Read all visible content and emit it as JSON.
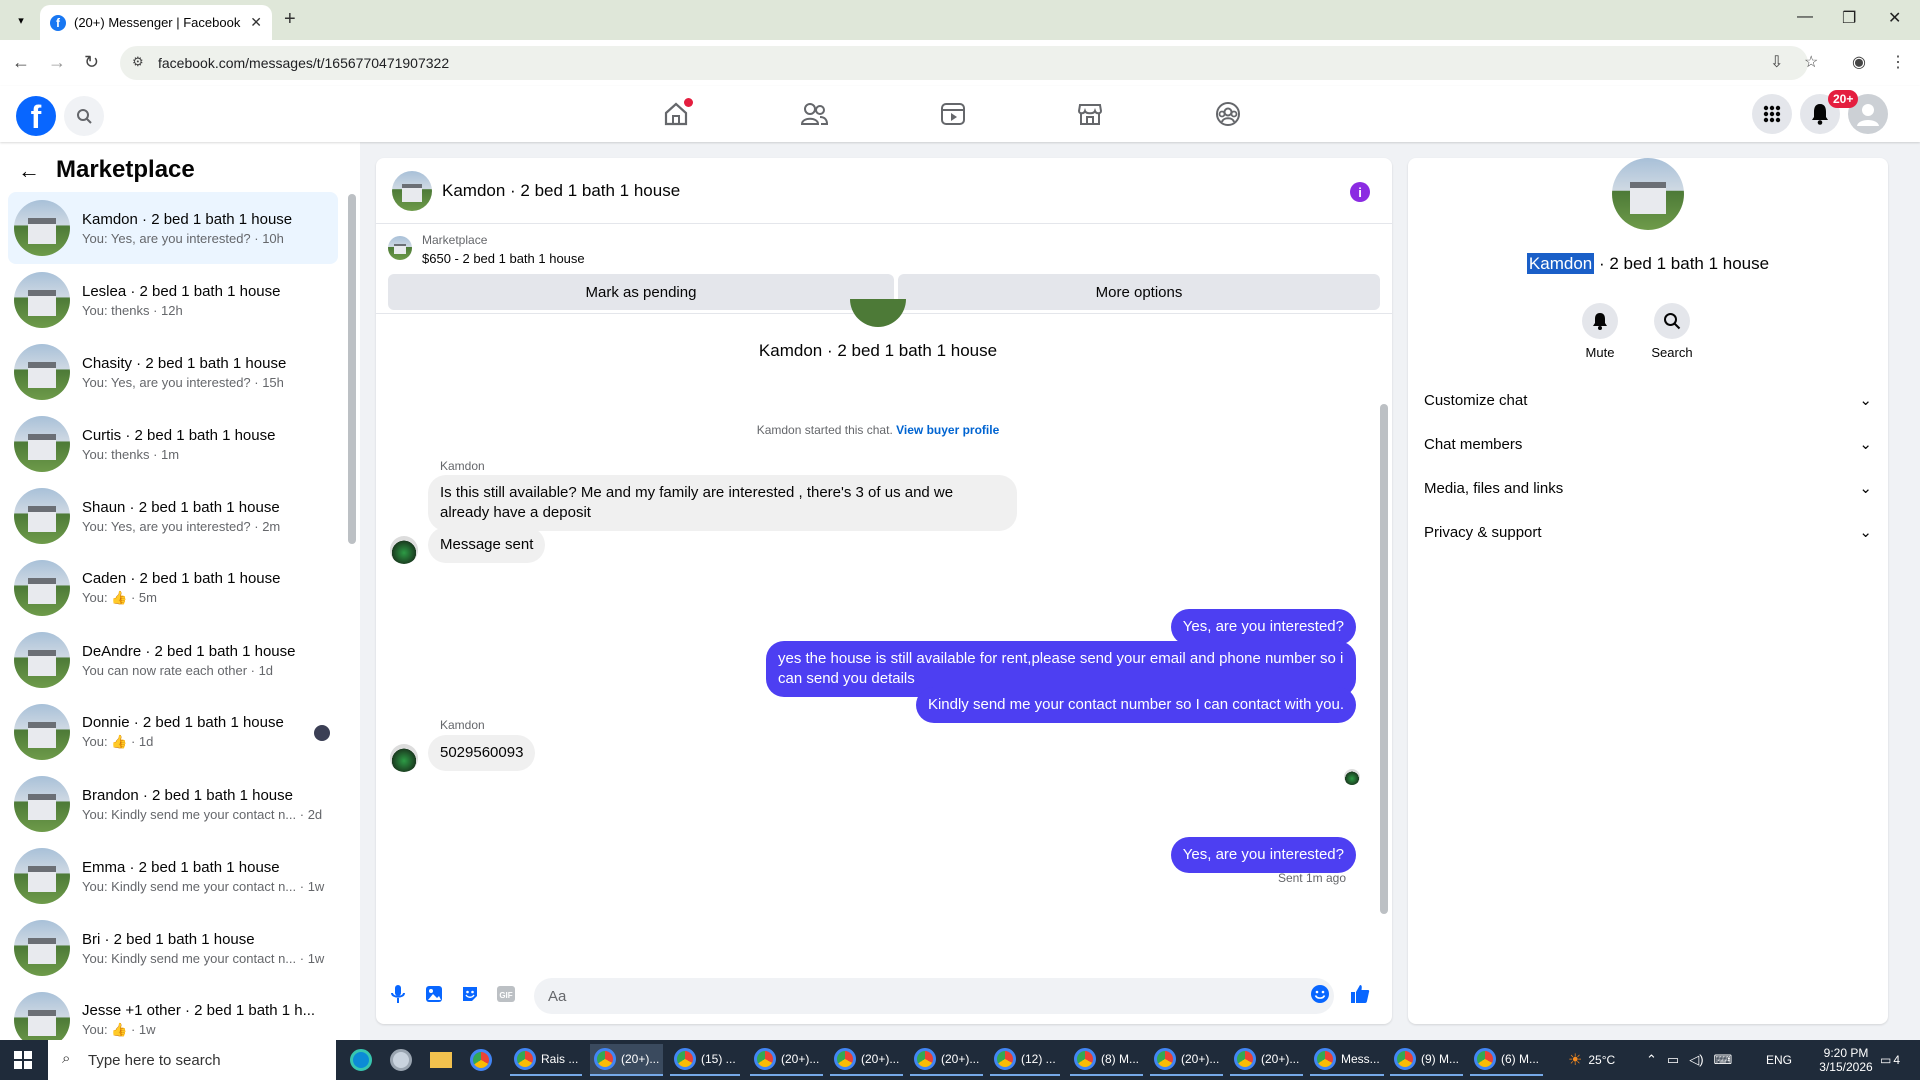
{
  "browser": {
    "tab_title": "(20+) Messenger | Facebook",
    "new_tab": "+",
    "url": "facebook.com/messages/t/1656770471907322"
  },
  "fb": {
    "notif_badge": "20+",
    "nav_icons": [
      "home-icon",
      "friends-icon",
      "video-icon",
      "marketplace-icon",
      "groups-icon"
    ]
  },
  "sidebar": {
    "title": "Marketplace",
    "conversations": [
      {
        "name": "Kamdon · 2 bed 1 bath 1 house",
        "preview": "You: Yes, are you interested? · 10h"
      },
      {
        "name": "Leslea · 2 bed 1 bath 1 house",
        "preview": "You: thenks · 12h"
      },
      {
        "name": "Chasity · 2 bed 1 bath 1 house",
        "preview": "You: Yes, are you interested? · 15h"
      },
      {
        "name": "Curtis · 2 bed 1 bath 1 house",
        "preview": "You: thenks · 1m"
      },
      {
        "name": "Shaun · 2 bed 1 bath 1 house",
        "preview": "You: Yes, are you interested? · 2m"
      },
      {
        "name": "Caden · 2 bed 1 bath 1 house",
        "preview": "You: 👍 · 5m"
      },
      {
        "name": "DeAndre · 2 bed 1 bath 1 house",
        "preview": "You can now rate each other · 1d"
      },
      {
        "name": "Donnie · 2 bed 1 bath 1 house",
        "preview": "You: 👍 · 1d"
      },
      {
        "name": "Brandon · 2 bed 1 bath 1 house",
        "preview": "You: Kindly send me your contact n... · 2d"
      },
      {
        "name": "Emma · 2 bed 1 bath 1 house",
        "preview": "You: Kindly send me your contact n... · 1w"
      },
      {
        "name": "Bri · 2 bed 1 bath 1 house",
        "preview": "You: Kindly send me your contact n... · 1w"
      },
      {
        "name": "Jesse +1 other · 2 bed 1 bath 1 h...",
        "preview": "You: 👍 · 1w"
      }
    ]
  },
  "chat": {
    "header_title": "Kamdon · 2 bed 1 bath 1 house",
    "listing_label": "Marketplace",
    "listing_detail": "$650 - 2 bed 1 bath 1 house",
    "mark_pending": "Mark as pending",
    "more_options": "More options",
    "intro_title": "Kamdon · 2 bed 1 bath 1 house",
    "started_text": "Kamdon started this chat.",
    "view_buyer": "View buyer profile",
    "sender_name": "Kamdon",
    "msg1": "Is this still available? Me and my family are interested , there's 3 of us and we already have a deposit",
    "msg2": "Message sent",
    "msg3": "Yes, are you interested?",
    "msg4": "yes the house is still available for rent,please send your email and phone number so i can send you details",
    "msg5": "Kindly send me your contact number so I can contact with you.",
    "sender_name2": "Kamdon",
    "msg6": "5029560093",
    "msg7": "Yes, are you interested?",
    "sent_status": "Sent 1m ago",
    "composer_placeholder": "Aa"
  },
  "info_panel": {
    "name_highlight": "Kamdon",
    "name_rest": " · 2 bed 1 bath 1 house",
    "mute": "Mute",
    "search": "Search",
    "sections": [
      "Customize chat",
      "Chat members",
      "Media, files and links",
      "Privacy & support"
    ]
  },
  "taskbar": {
    "search_placeholder": "Type here to search",
    "apps": [
      "Rais ...",
      "(20+)...",
      "(15) ...",
      "(20+)...",
      "(20+)...",
      "(20+)...",
      "(12) ...",
      "(8) M...",
      "(20+)...",
      "(20+)...",
      "Mess...",
      "(9) M...",
      "(6) M..."
    ],
    "weather": "25°C",
    "lang": "ENG",
    "time": "9:20 PM",
    "date": "3/15/2026",
    "notif_count": "4"
  }
}
